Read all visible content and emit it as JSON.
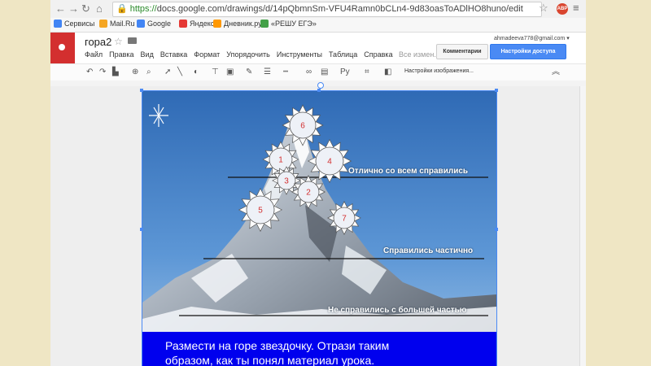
{
  "browser": {
    "url_prefix": "https://",
    "url_rest": "docs.google.com/drawings/d/14pQbmnSm-VFU4Ramn0bCLn4-9d83oasToADlHO8huno/edit",
    "extension_badge": "ABP"
  },
  "bookmarks": [
    {
      "label": "Сервисы",
      "color": "#4285f4"
    },
    {
      "label": "Mail.Ru",
      "color": "#f5a623"
    },
    {
      "label": "Google",
      "color": "#4285f4"
    },
    {
      "label": "Яндекс",
      "color": "#e53935"
    },
    {
      "label": "Дневник.ру",
      "color": "#ff9800"
    },
    {
      "label": "«РЕШУ ЕГЭ»",
      "color": "#43a047"
    }
  ],
  "doc": {
    "title": "гора2",
    "menu": [
      "Файл",
      "Правка",
      "Вид",
      "Вставка",
      "Формат",
      "Упорядочить",
      "Инструменты",
      "Таблица",
      "Справка"
    ],
    "saved_status": "Все измен.",
    "user_email": "ahmadeeva778@gmail.com ▾",
    "comments_button": "Комментарии",
    "share_button": "Настройки доступа"
  },
  "toolbar": {
    "font_label": "Ру",
    "image_options": "Настройки изображения..."
  },
  "drawing": {
    "levels": [
      {
        "label": "Отлично со всем справились"
      },
      {
        "label": "Справились частично"
      },
      {
        "label": "Не справились с большей частью"
      }
    ],
    "stars": [
      "6",
      "1",
      "4",
      "3",
      "2",
      "5",
      "7"
    ],
    "banner_line1": "Размести на горе звездочку. Отрази таким",
    "banner_line2": "образом, как ты понял материал урока."
  },
  "colors": {
    "accent_blue": "#4a8af4",
    "banner_blue": "#0000ee",
    "star_number": "#d32f2f",
    "docs_red": "#d32f2f"
  }
}
